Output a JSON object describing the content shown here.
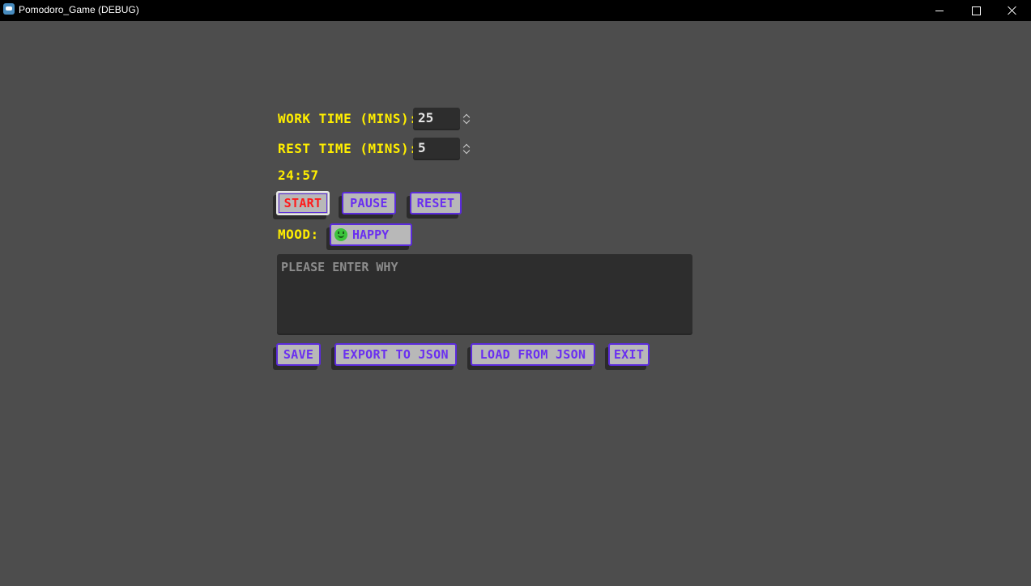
{
  "window": {
    "title": "Pomodoro_Game (DEBUG)"
  },
  "settings": {
    "work_label": "WORK TIME (MINS):",
    "work_value": "25",
    "rest_label": "REST TIME (MINS):",
    "rest_value": "5"
  },
  "timer": {
    "display": "24:57"
  },
  "controls": {
    "start": "START",
    "pause": "PAUSE",
    "reset": "RESET"
  },
  "mood": {
    "label": "MOOD:",
    "selected": "HAPPY",
    "selected_icon": "smiley-icon"
  },
  "note": {
    "placeholder": "PLEASE ENTER WHY"
  },
  "actions": {
    "save": "SAVE",
    "export": "EXPORT TO JSON",
    "load": "LOAD FROM JSON",
    "exit": "EXIT"
  },
  "colors": {
    "background": "#4d4d4d",
    "label_yellow": "#ffee00",
    "button_text": "#6a2ff0",
    "button_border": "#5b2bdc",
    "active_text": "#ff1a1a"
  }
}
